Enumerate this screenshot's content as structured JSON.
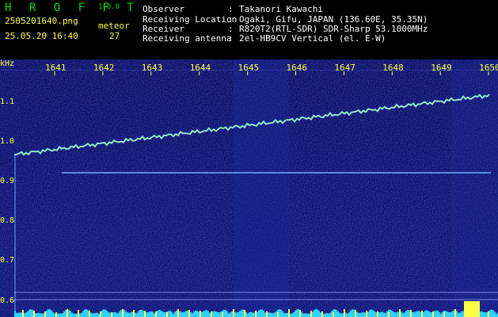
{
  "header": {
    "app_name": "H R O F F T",
    "version": "1.0.0",
    "filename": "2505201640.png",
    "datetime": "25.05.20 16:40",
    "meteor_label": "meteor",
    "meteor_count": "27",
    "info": [
      {
        "key": "Observer",
        "sep": ":",
        "value": "Takanori Kawachi"
      },
      {
        "key": "Receiving Location",
        "sep": ":",
        "value": "Ogaki, Gifu, JAPAN (136.60E, 35.35N)"
      },
      {
        "key": "Receiver",
        "sep": ":",
        "value": "R820T2(RTL-SDR) SDR-Sharp 53.1000MHz"
      },
      {
        "key": "Receiving antenna",
        "sep": ":",
        "value": "2el-HB9CV Vertical (el. E-W)"
      }
    ]
  },
  "spectrogram": {
    "y_unit": "kHz",
    "x_ticks": [
      "1641",
      "1642",
      "1643",
      "1644",
      "1645",
      "1646",
      "1647",
      "1648",
      "1649",
      "1650"
    ],
    "y_ticks": [
      "1.1",
      "1.0",
      "0.9",
      "0.8",
      "0.7",
      "0.6"
    ],
    "colors": {
      "background": "#0a0a60",
      "signal": "#6cd0ff",
      "hot": "#ffff40",
      "tick": "#ffff40"
    }
  }
}
